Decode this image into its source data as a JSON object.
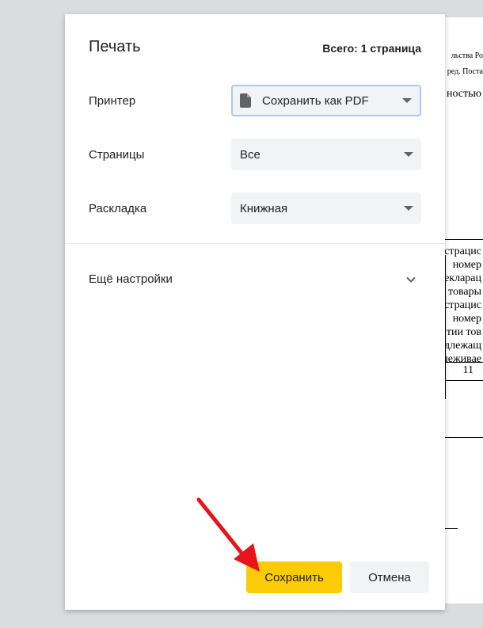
{
  "dialog": {
    "title": "Печать",
    "total": "Всего: 1 страница",
    "rows": [
      {
        "label": "Принтер",
        "value": "Сохранить как PDF",
        "icon": "document-icon"
      },
      {
        "label": "Страницы",
        "value": "Все"
      },
      {
        "label": "Раскладка",
        "value": "Книжная"
      }
    ],
    "more_settings": "Ещё настройки",
    "save_label": "Сохранить",
    "cancel_label": "Отмена"
  },
  "preview": {
    "header_lines": [
      "льства Ро",
      "ред. Поста"
    ],
    "subtitle": "ностью",
    "table_lines": [
      "страцис",
      "номер",
      "екларац",
      "товары",
      "страцис",
      "номер",
      "тии тов",
      "длежащ",
      "леживае"
    ],
    "column_number": "11"
  },
  "colors": {
    "accent_button": "#fbcb05",
    "annotation_arrow": "#e8141b",
    "focus_border": "#a8c7fa"
  }
}
